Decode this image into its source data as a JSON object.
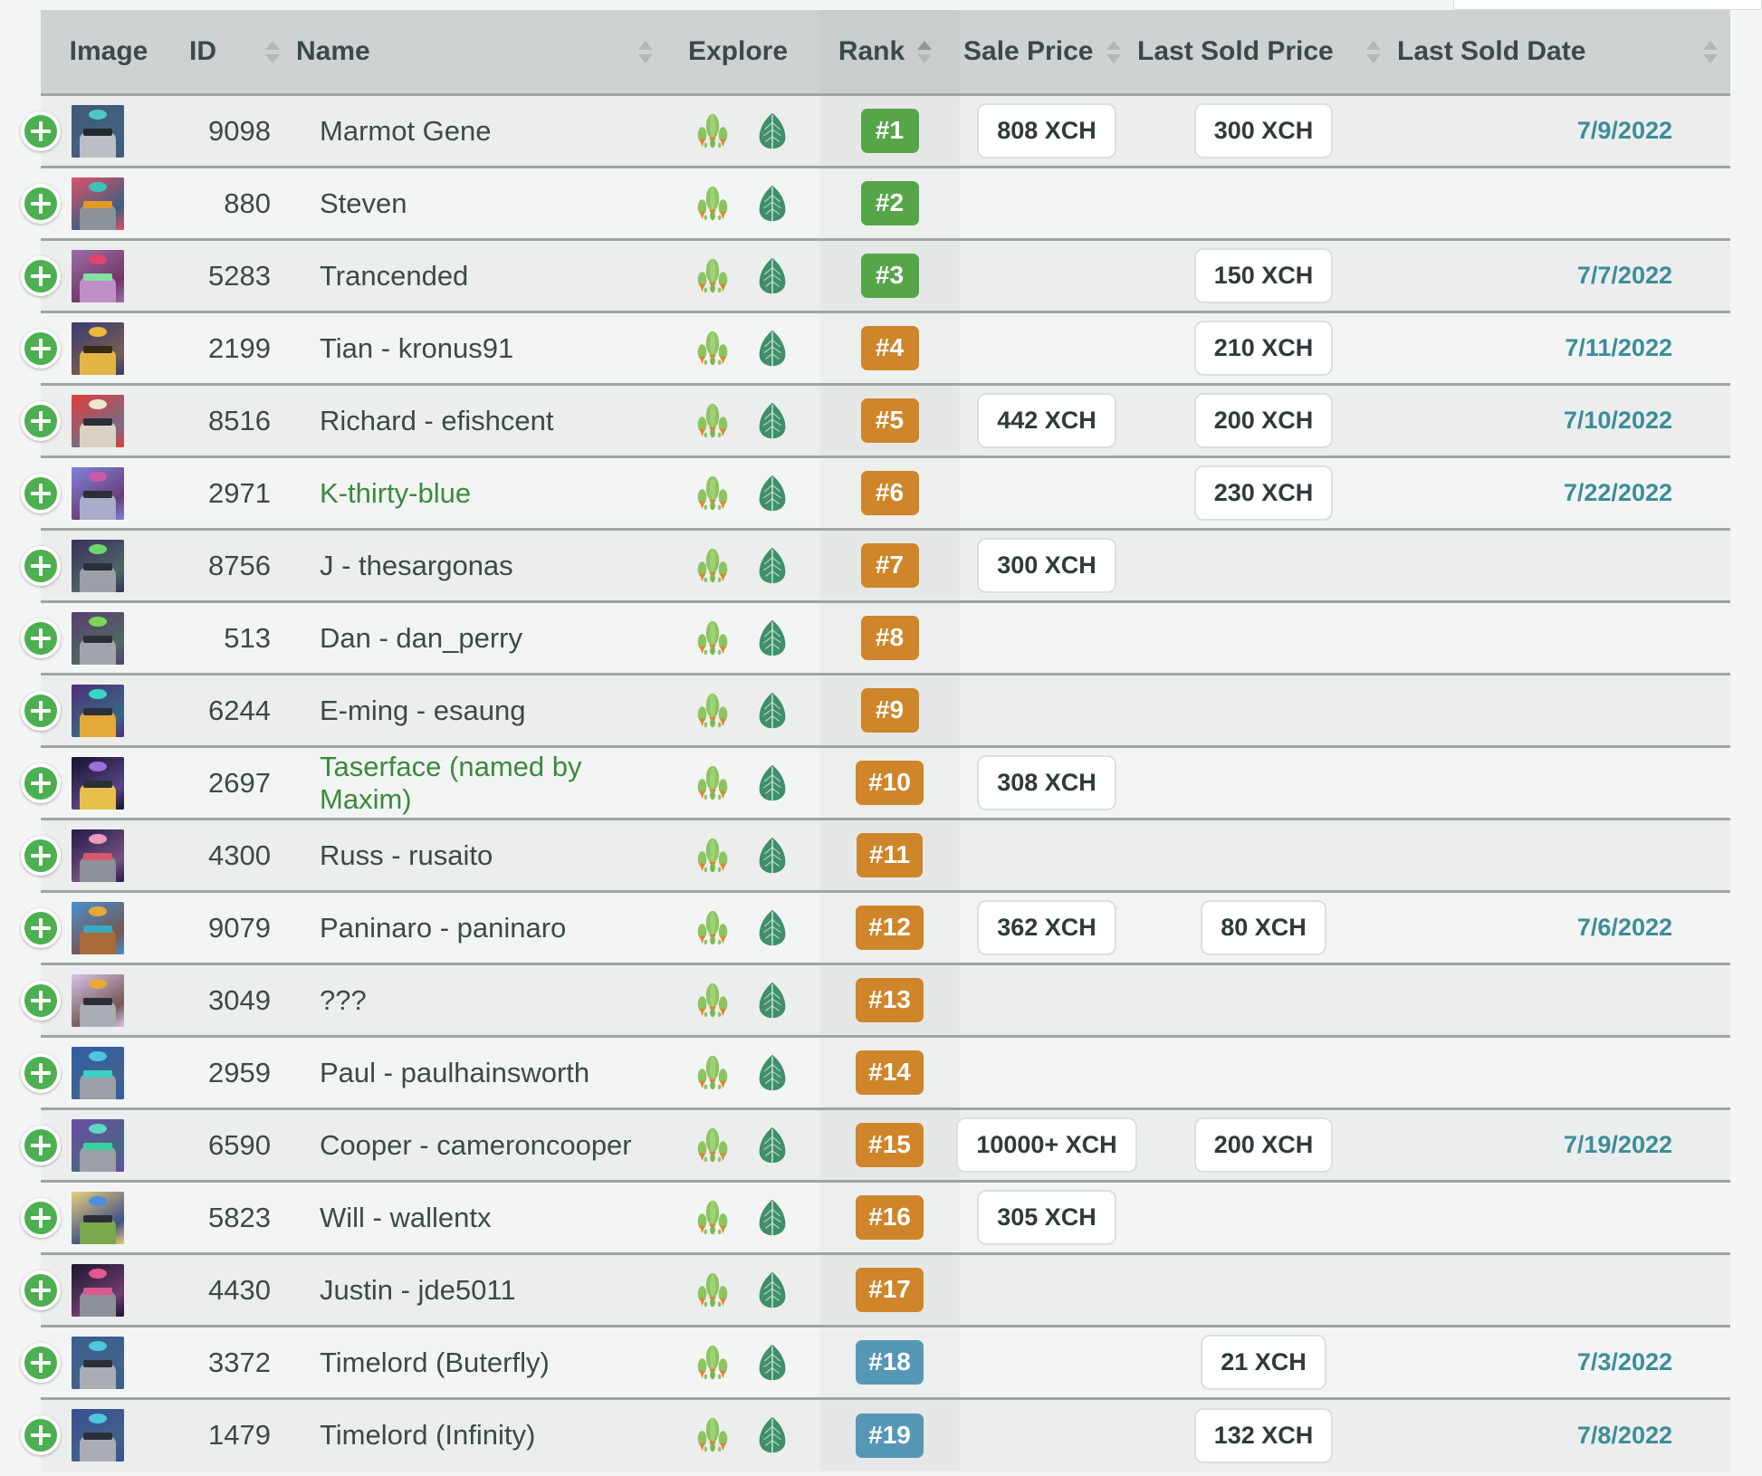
{
  "table": {
    "columns": [
      {
        "key": "image",
        "label": "Image",
        "align": "center",
        "sortable": false
      },
      {
        "key": "id",
        "label": "ID",
        "align": "left",
        "sortable": true,
        "sort": "none"
      },
      {
        "key": "name",
        "label": "Name",
        "align": "left",
        "sortable": true,
        "sort": "none"
      },
      {
        "key": "explore",
        "label": "Explore",
        "align": "center",
        "sortable": false
      },
      {
        "key": "rank",
        "label": "Rank",
        "align": "center",
        "sortable": true,
        "sort": "asc"
      },
      {
        "key": "sale_price",
        "label": "Sale Price",
        "align": "left",
        "sortable": true,
        "sort": "none"
      },
      {
        "key": "last_sold_price",
        "label": "Last Sold Price",
        "align": "left",
        "sortable": true,
        "sort": "none"
      },
      {
        "key": "last_sold_date",
        "label": "Last Sold Date",
        "align": "left",
        "sortable": true,
        "sort": "none"
      }
    ],
    "explore_icons": [
      {
        "name": "spacescan-icon",
        "title": "SpaceScan"
      },
      {
        "name": "chia-leaf-icon",
        "title": "Chia"
      }
    ],
    "add_button_label": "+",
    "rows": [
      {
        "id": "9098",
        "name": "Marmot Gene",
        "name_color": "default",
        "rank": "#1",
        "rank_color": "green",
        "sale_price": "808 XCH",
        "last_sold_price": "300 XCH",
        "last_sold_date": "7/9/2022",
        "avatar": {
          "bg": "#3f5a77",
          "accent": "#4fc6c0",
          "body": "#b9bfc4",
          "eyes": "#23272e"
        }
      },
      {
        "id": "880",
        "name": "Steven",
        "name_color": "default",
        "rank": "#2",
        "rank_color": "green",
        "sale_price": "",
        "last_sold_price": "",
        "last_sold_date": "",
        "avatar": {
          "bg": "#e0506b",
          "accent": "#3ec2bc",
          "body": "#8b9298",
          "eyes": "#e09a2a"
        }
      },
      {
        "id": "5283",
        "name": "Trancended",
        "name_color": "default",
        "rank": "#3",
        "rank_color": "green",
        "sale_price": "",
        "last_sold_price": "150 XCH",
        "last_sold_date": "7/7/2022",
        "avatar": {
          "bg": "#9b6fa8",
          "accent": "#e0436e",
          "body": "#c08fc9",
          "eyes": "#7fe3a0"
        }
      },
      {
        "id": "2199",
        "name": "Tian - kronus91",
        "name_color": "default",
        "rank": "#4",
        "rank_color": "orange",
        "sale_price": "",
        "last_sold_price": "210 XCH",
        "last_sold_date": "7/11/2022",
        "avatar": {
          "bg": "#3a3a72",
          "accent": "#e8b93a",
          "body": "#e3b545",
          "eyes": "#3a2a12"
        }
      },
      {
        "id": "8516",
        "name": "Richard - efishcent",
        "name_color": "default",
        "rank": "#5",
        "rank_color": "orange",
        "sale_price": "442 XCH",
        "last_sold_price": "200 XCH",
        "last_sold_date": "7/10/2022",
        "avatar": {
          "bg": "#e03c3c",
          "accent": "#f2e6d0",
          "body": "#d9d2c4",
          "eyes": "#2a2f38"
        }
      },
      {
        "id": "2971",
        "name": "K-thirty-blue",
        "name_color": "green",
        "rank": "#6",
        "rank_color": "orange",
        "sale_price": "",
        "last_sold_price": "230 XCH",
        "last_sold_date": "7/22/2022",
        "avatar": {
          "bg": "#7f83d8",
          "accent": "#c85aa8",
          "body": "#a8adc9",
          "eyes": "#2a2f38"
        }
      },
      {
        "id": "8756",
        "name": "J - thesargonas",
        "name_color": "default",
        "rank": "#7",
        "rank_color": "orange",
        "sale_price": "300 XCH",
        "last_sold_price": "",
        "last_sold_date": "",
        "avatar": {
          "bg": "#3b2f5e",
          "accent": "#6fd66f",
          "body": "#9aa0a6",
          "eyes": "#2a2f38"
        }
      },
      {
        "id": "513",
        "name": "Dan - dan_perry",
        "name_color": "default",
        "rank": "#8",
        "rank_color": "orange",
        "sale_price": "",
        "last_sold_price": "",
        "last_sold_date": "",
        "avatar": {
          "bg": "#5a3f73",
          "accent": "#7bd85a",
          "body": "#a0a6ac",
          "eyes": "#2a2f38"
        }
      },
      {
        "id": "6244",
        "name": "E-ming - esaung",
        "name_color": "default",
        "rank": "#9",
        "rank_color": "orange",
        "sale_price": "",
        "last_sold_price": "",
        "last_sold_date": "",
        "avatar": {
          "bg": "#4e2f7a",
          "accent": "#39d6c6",
          "body": "#e3a93a",
          "eyes": "#2a2f38"
        }
      },
      {
        "id": "2697",
        "name": "Taserface (named by Maxim)",
        "name_color": "green",
        "rank": "#10",
        "rank_color": "orange",
        "sale_price": "308 XCH",
        "last_sold_price": "",
        "last_sold_date": "",
        "avatar": {
          "bg": "#16122e",
          "accent": "#9a6fd8",
          "body": "#e8bf4a",
          "eyes": "#2a2f38"
        }
      },
      {
        "id": "4300",
        "name": "Russ - rusaito",
        "name_color": "default",
        "rank": "#11",
        "rank_color": "orange",
        "sale_price": "",
        "last_sold_price": "",
        "last_sold_date": "",
        "avatar": {
          "bg": "#221b4a",
          "accent": "#f09ac0",
          "body": "#8d9298",
          "eyes": "#d8566e"
        }
      },
      {
        "id": "9079",
        "name": "Paninaro - paninaro",
        "name_color": "default",
        "rank": "#12",
        "rank_color": "orange",
        "sale_price": "362 XCH",
        "last_sold_price": "80 XCH",
        "last_sold_date": "7/6/2022",
        "avatar": {
          "bg": "#4a8fcf",
          "accent": "#e8a93a",
          "body": "#a86a38",
          "eyes": "#3aa9c4"
        }
      },
      {
        "id": "3049",
        "name": "???",
        "name_color": "default",
        "rank": "#13",
        "rank_color": "orange",
        "sale_price": "",
        "last_sold_price": "",
        "last_sold_date": "",
        "avatar": {
          "bg": "#d8c4ea",
          "accent": "#e8a93a",
          "body": "#a8aeb4",
          "eyes": "#2a2f38"
        }
      },
      {
        "id": "2959",
        "name": "Paul - paulhainsworth",
        "name_color": "default",
        "rank": "#14",
        "rank_color": "orange",
        "sale_price": "",
        "last_sold_price": "",
        "last_sold_date": "",
        "avatar": {
          "bg": "#2f5fa8",
          "accent": "#4fc6e0",
          "body": "#9aa0a6",
          "eyes": "#3ad0c4"
        }
      },
      {
        "id": "6590",
        "name": "Cooper - cameroncooper",
        "name_color": "default",
        "rank": "#15",
        "rank_color": "orange",
        "sale_price": "10000+ XCH",
        "last_sold_price": "200 XCH",
        "last_sold_date": "7/19/2022",
        "avatar": {
          "bg": "#6f4aa8",
          "accent": "#5fd8c0",
          "body": "#9aa0a6",
          "eyes": "#3ad0a0"
        }
      },
      {
        "id": "5823",
        "name": "Will - wallentx",
        "name_color": "default",
        "rank": "#16",
        "rank_color": "orange",
        "sale_price": "305 XCH",
        "last_sold_price": "",
        "last_sold_date": "",
        "avatar": {
          "bg": "#e8d07a",
          "accent": "#4f8fd8",
          "body": "#7aa84a",
          "eyes": "#2a2f38"
        }
      },
      {
        "id": "4430",
        "name": "Justin - jde5011",
        "name_color": "default",
        "rank": "#17",
        "rank_color": "orange",
        "sale_price": "",
        "last_sold_price": "",
        "last_sold_date": "",
        "avatar": {
          "bg": "#1b1630",
          "accent": "#e05a8f",
          "body": "#8d9298",
          "eyes": "#d85a8f"
        }
      },
      {
        "id": "3372",
        "name": "Timelord (Buterfly)",
        "name_color": "default",
        "rank": "#18",
        "rank_color": "blue",
        "sale_price": "",
        "last_sold_price": "21 XCH",
        "last_sold_date": "7/3/2022",
        "avatar": {
          "bg": "#3a5f8f",
          "accent": "#4fc6e0",
          "body": "#a8aeb4",
          "eyes": "#2a2f38"
        }
      },
      {
        "id": "1479",
        "name": "Timelord (Infinity)",
        "name_color": "default",
        "rank": "#19",
        "rank_color": "blue",
        "sale_price": "",
        "last_sold_price": "132 XCH",
        "last_sold_date": "7/8/2022",
        "avatar": {
          "bg": "#3a4f8f",
          "accent": "#4fc6e0",
          "body": "#a8aeb4",
          "eyes": "#2a2f38"
        }
      }
    ]
  },
  "colors": {
    "header_bg": "#ced2d2",
    "rank_green": "#56a649",
    "rank_orange": "#cf8529",
    "rank_blue": "#5697b6",
    "date_text": "#3c8d99",
    "name_green": "#3b8a3b",
    "add_button": "#4caf50"
  }
}
